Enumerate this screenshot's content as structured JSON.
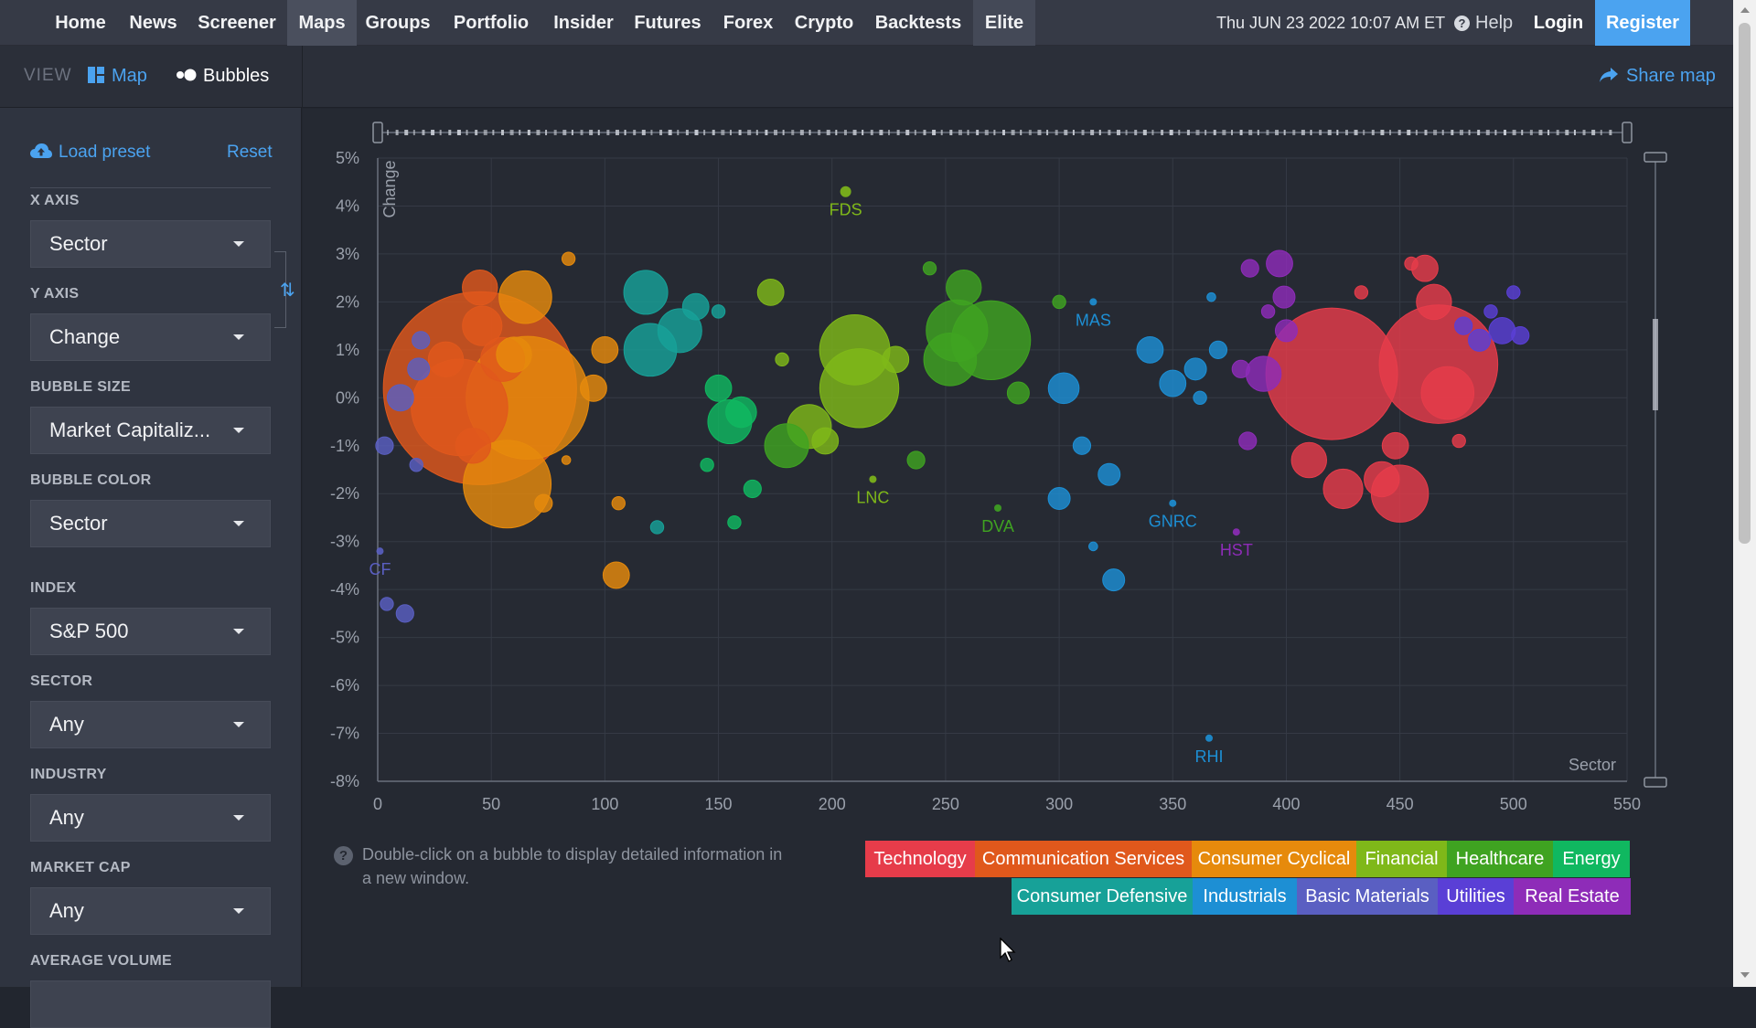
{
  "nav": {
    "items": [
      "Home",
      "News",
      "Screener",
      "Maps",
      "Groups",
      "Portfolio",
      "Insider",
      "Futures",
      "Forex",
      "Crypto",
      "Backtests",
      "Elite"
    ],
    "active": "Maps",
    "datetime": "Thu JUN 23 2022 10:07 AM ET",
    "help": "Help",
    "login": "Login",
    "register": "Register"
  },
  "viewbar": {
    "view_label": "VIEW",
    "map": "Map",
    "bubbles": "Bubbles",
    "share": "Share map"
  },
  "sidebar": {
    "load_preset": "Load preset",
    "reset": "Reset",
    "fields": [
      {
        "label": "X AXIS",
        "value": "Sector"
      },
      {
        "label": "Y AXIS",
        "value": "Change"
      },
      {
        "label": "BUBBLE SIZE",
        "value": "Market Capitaliz..."
      },
      {
        "label": "BUBBLE COLOR",
        "value": "Sector"
      },
      {
        "label": "INDEX",
        "value": "S&P 500"
      },
      {
        "label": "SECTOR",
        "value": "Any"
      },
      {
        "label": "INDUSTRY",
        "value": "Any"
      },
      {
        "label": "MARKET CAP",
        "value": "Any"
      },
      {
        "label": "AVERAGE VOLUME",
        "value": ""
      }
    ]
  },
  "hint": "Double-click on a bubble to display detailed information in a new window.",
  "legend": [
    {
      "name": "Technology",
      "color": "#e63c4a"
    },
    {
      "name": "Communication Services",
      "color": "#e0581c"
    },
    {
      "name": "Consumer Cyclical",
      "color": "#e68a0c"
    },
    {
      "name": "Financial",
      "color": "#7fb819"
    },
    {
      "name": "Healthcare",
      "color": "#3fa321"
    },
    {
      "name": "Energy",
      "color": "#10b860"
    },
    {
      "name": "Consumer Defensive",
      "color": "#17a198"
    },
    {
      "name": "Industrials",
      "color": "#1d8fd4"
    },
    {
      "name": "Basic Materials",
      "color": "#5a5fc2"
    },
    {
      "name": "Utilities",
      "color": "#5a3fd6"
    },
    {
      "name": "Real Estate",
      "color": "#8e2cb8"
    }
  ],
  "chart_data": {
    "type": "scatter",
    "xlabel": "Sector",
    "ylabel": "Change",
    "xlim": [
      0,
      550
    ],
    "ylim": [
      -8,
      5
    ],
    "xticks": [
      0,
      50,
      100,
      150,
      200,
      250,
      300,
      350,
      400,
      450,
      500,
      550
    ],
    "yticks": [
      5,
      4,
      3,
      2,
      1,
      0,
      -1,
      -2,
      -3,
      -4,
      -5,
      -6,
      -7,
      -8
    ],
    "ytick_labels": [
      "5%",
      "4%",
      "3%",
      "2%",
      "1%",
      "0%",
      "-1%",
      "-2%",
      "-3%",
      "-4%",
      "-5%",
      "-6%",
      "-7%",
      "-8%"
    ],
    "grid": true,
    "labeled_points": [
      {
        "label": "FDS",
        "x": 206,
        "y": 4.3,
        "sector": "Financial"
      },
      {
        "label": "LNC",
        "x": 218,
        "y": -1.7,
        "sector": "Financial"
      },
      {
        "label": "DVA",
        "x": 273,
        "y": -2.3,
        "sector": "Healthcare"
      },
      {
        "label": "MAS",
        "x": 315,
        "y": 2.0,
        "sector": "Industrials"
      },
      {
        "label": "GNRC",
        "x": 350,
        "y": -2.2,
        "sector": "Industrials"
      },
      {
        "label": "HST",
        "x": 378,
        "y": -2.8,
        "sector": "Real Estate"
      },
      {
        "label": "RHI",
        "x": 366,
        "y": -7.1,
        "sector": "Industrials"
      },
      {
        "label": "CF",
        "x": 1,
        "y": -3.2,
        "sector": "Basic Materials"
      }
    ],
    "points": [
      {
        "x": 45,
        "y": 0.2,
        "size": 44,
        "sector": "Communication Services"
      },
      {
        "x": 36,
        "y": -0.2,
        "size": 22,
        "sector": "Communication Services"
      },
      {
        "x": 45,
        "y": 2.3,
        "size": 8,
        "sector": "Communication Services"
      },
      {
        "x": 46,
        "y": 1.5,
        "size": 9,
        "sector": "Communication Services"
      },
      {
        "x": 42,
        "y": -1.0,
        "size": 8,
        "sector": "Communication Services"
      },
      {
        "x": 55,
        "y": 0.8,
        "size": 10,
        "sector": "Communication Services"
      },
      {
        "x": 30,
        "y": 0.8,
        "size": 8,
        "sector": "Communication Services"
      },
      {
        "x": 66,
        "y": 0.0,
        "size": 28,
        "sector": "Consumer Cyclical"
      },
      {
        "x": 57,
        "y": -1.8,
        "size": 20,
        "sector": "Consumer Cyclical"
      },
      {
        "x": 65,
        "y": 2.1,
        "size": 12,
        "sector": "Consumer Cyclical"
      },
      {
        "x": 73,
        "y": -2.2,
        "size": 4,
        "sector": "Consumer Cyclical"
      },
      {
        "x": 84,
        "y": 2.9,
        "size": 3,
        "sector": "Consumer Cyclical"
      },
      {
        "x": 95,
        "y": 0.2,
        "size": 6,
        "sector": "Consumer Cyclical"
      },
      {
        "x": 105,
        "y": -3.7,
        "size": 6,
        "sector": "Consumer Cyclical"
      },
      {
        "x": 106,
        "y": -2.2,
        "size": 3,
        "sector": "Consumer Cyclical"
      },
      {
        "x": 100,
        "y": 1.0,
        "size": 6,
        "sector": "Consumer Cyclical"
      },
      {
        "x": 83,
        "y": -1.3,
        "size": 2,
        "sector": "Consumer Cyclical"
      },
      {
        "x": 60,
        "y": 0.9,
        "size": 8,
        "sector": "Consumer Cyclical"
      },
      {
        "x": 210,
        "y": 1.0,
        "size": 16,
        "sector": "Financial"
      },
      {
        "x": 212,
        "y": 0.2,
        "size": 18,
        "sector": "Financial"
      },
      {
        "x": 190,
        "y": -0.6,
        "size": 10,
        "sector": "Financial"
      },
      {
        "x": 197,
        "y": -0.9,
        "size": 6,
        "sector": "Financial"
      },
      {
        "x": 173,
        "y": 2.2,
        "size": 6,
        "sector": "Financial"
      },
      {
        "x": 178,
        "y": 0.8,
        "size": 3,
        "sector": "Financial"
      },
      {
        "x": 228,
        "y": 0.8,
        "size": 6,
        "sector": "Financial"
      },
      {
        "x": 180,
        "y": -1.0,
        "size": 10,
        "sector": "Healthcare"
      },
      {
        "x": 255,
        "y": 1.4,
        "size": 14,
        "sector": "Healthcare"
      },
      {
        "x": 270,
        "y": 1.2,
        "size": 18,
        "sector": "Healthcare"
      },
      {
        "x": 252,
        "y": 0.8,
        "size": 12,
        "sector": "Healthcare"
      },
      {
        "x": 237,
        "y": -1.3,
        "size": 4,
        "sector": "Healthcare"
      },
      {
        "x": 282,
        "y": 0.1,
        "size": 5,
        "sector": "Healthcare"
      },
      {
        "x": 258,
        "y": 2.3,
        "size": 8,
        "sector": "Healthcare"
      },
      {
        "x": 300,
        "y": 2.0,
        "size": 3,
        "sector": "Healthcare"
      },
      {
        "x": 243,
        "y": 2.7,
        "size": 3,
        "sector": "Healthcare"
      },
      {
        "x": 155,
        "y": -0.5,
        "size": 10,
        "sector": "Energy"
      },
      {
        "x": 160,
        "y": -0.3,
        "size": 7,
        "sector": "Energy"
      },
      {
        "x": 150,
        "y": 0.2,
        "size": 6,
        "sector": "Energy"
      },
      {
        "x": 165,
        "y": -1.9,
        "size": 4,
        "sector": "Energy"
      },
      {
        "x": 157,
        "y": -2.6,
        "size": 3,
        "sector": "Energy"
      },
      {
        "x": 145,
        "y": -1.4,
        "size": 3,
        "sector": "Energy"
      },
      {
        "x": 118,
        "y": 2.2,
        "size": 10,
        "sector": "Consumer Defensive"
      },
      {
        "x": 120,
        "y": 1.0,
        "size": 12,
        "sector": "Consumer Defensive"
      },
      {
        "x": 133,
        "y": 1.4,
        "size": 10,
        "sector": "Consumer Defensive"
      },
      {
        "x": 140,
        "y": 1.9,
        "size": 6,
        "sector": "Consumer Defensive"
      },
      {
        "x": 123,
        "y": -2.7,
        "size": 3,
        "sector": "Consumer Defensive"
      },
      {
        "x": 150,
        "y": 1.8,
        "size": 3,
        "sector": "Consumer Defensive"
      },
      {
        "x": 302,
        "y": 0.2,
        "size": 7,
        "sector": "Industrials"
      },
      {
        "x": 310,
        "y": -1.0,
        "size": 4,
        "sector": "Industrials"
      },
      {
        "x": 322,
        "y": -1.6,
        "size": 5,
        "sector": "Industrials"
      },
      {
        "x": 300,
        "y": -2.1,
        "size": 5,
        "sector": "Industrials"
      },
      {
        "x": 324,
        "y": -3.8,
        "size": 5,
        "sector": "Industrials"
      },
      {
        "x": 340,
        "y": 1.0,
        "size": 6,
        "sector": "Industrials"
      },
      {
        "x": 350,
        "y": 0.3,
        "size": 6,
        "sector": "Industrials"
      },
      {
        "x": 360,
        "y": 0.6,
        "size": 5,
        "sector": "Industrials"
      },
      {
        "x": 370,
        "y": 1.0,
        "size": 4,
        "sector": "Industrials"
      },
      {
        "x": 367,
        "y": 2.1,
        "size": 2,
        "sector": "Industrials"
      },
      {
        "x": 315,
        "y": -3.1,
        "size": 2,
        "sector": "Industrials"
      },
      {
        "x": 362,
        "y": 0.0,
        "size": 3,
        "sector": "Industrials"
      },
      {
        "x": 10,
        "y": 0.0,
        "size": 6,
        "sector": "Basic Materials"
      },
      {
        "x": 18,
        "y": 0.6,
        "size": 5,
        "sector": "Basic Materials"
      },
      {
        "x": 3,
        "y": -1.0,
        "size": 4,
        "sector": "Basic Materials"
      },
      {
        "x": 17,
        "y": -1.4,
        "size": 3,
        "sector": "Basic Materials"
      },
      {
        "x": 12,
        "y": -4.5,
        "size": 4,
        "sector": "Basic Materials"
      },
      {
        "x": 4,
        "y": -4.3,
        "size": 3,
        "sector": "Basic Materials"
      },
      {
        "x": 19,
        "y": 1.2,
        "size": 4,
        "sector": "Basic Materials"
      },
      {
        "x": 495,
        "y": 1.4,
        "size": 6,
        "sector": "Utilities"
      },
      {
        "x": 485,
        "y": 1.2,
        "size": 5,
        "sector": "Utilities"
      },
      {
        "x": 503,
        "y": 1.3,
        "size": 4,
        "sector": "Utilities"
      },
      {
        "x": 500,
        "y": 2.2,
        "size": 3,
        "sector": "Utilities"
      },
      {
        "x": 490,
        "y": 1.8,
        "size": 3,
        "sector": "Utilities"
      },
      {
        "x": 478,
        "y": 1.5,
        "size": 4,
        "sector": "Utilities"
      },
      {
        "x": 420,
        "y": 0.5,
        "size": 30,
        "sector": "Technology"
      },
      {
        "x": 467,
        "y": 0.7,
        "size": 27,
        "sector": "Technology"
      },
      {
        "x": 471,
        "y": 0.1,
        "size": 12,
        "sector": "Technology"
      },
      {
        "x": 450,
        "y": -2.0,
        "size": 13,
        "sector": "Technology"
      },
      {
        "x": 442,
        "y": -1.7,
        "size": 8,
        "sector": "Technology"
      },
      {
        "x": 410,
        "y": -1.3,
        "size": 8,
        "sector": "Technology"
      },
      {
        "x": 425,
        "y": -1.9,
        "size": 9,
        "sector": "Technology"
      },
      {
        "x": 465,
        "y": 2.0,
        "size": 8,
        "sector": "Technology"
      },
      {
        "x": 448,
        "y": -1.0,
        "size": 6,
        "sector": "Technology"
      },
      {
        "x": 461,
        "y": 2.7,
        "size": 6,
        "sector": "Technology"
      },
      {
        "x": 455,
        "y": 2.8,
        "size": 3,
        "sector": "Technology"
      },
      {
        "x": 433,
        "y": 2.2,
        "size": 3,
        "sector": "Technology"
      },
      {
        "x": 476,
        "y": -0.9,
        "size": 3,
        "sector": "Technology"
      },
      {
        "x": 390,
        "y": 0.5,
        "size": 8,
        "sector": "Real Estate"
      },
      {
        "x": 400,
        "y": 1.4,
        "size": 5,
        "sector": "Real Estate"
      },
      {
        "x": 397,
        "y": 2.8,
        "size": 6,
        "sector": "Real Estate"
      },
      {
        "x": 399,
        "y": 2.1,
        "size": 5,
        "sector": "Real Estate"
      },
      {
        "x": 384,
        "y": 2.7,
        "size": 4,
        "sector": "Real Estate"
      },
      {
        "x": 383,
        "y": -0.9,
        "size": 4,
        "sector": "Real Estate"
      },
      {
        "x": 392,
        "y": 1.8,
        "size": 3,
        "sector": "Real Estate"
      },
      {
        "x": 380,
        "y": 0.6,
        "size": 4,
        "sector": "Real Estate"
      }
    ]
  }
}
